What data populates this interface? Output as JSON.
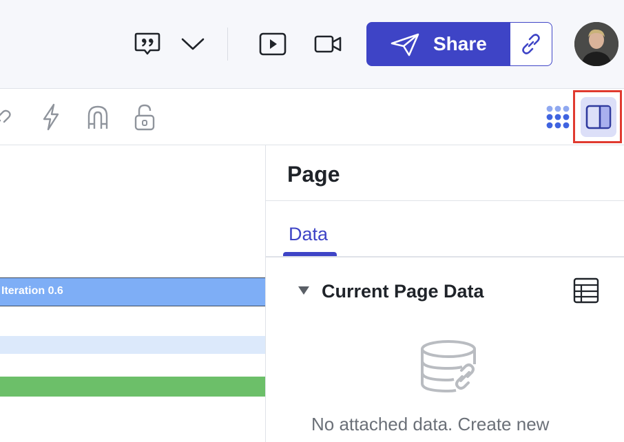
{
  "header": {
    "share_label": "Share",
    "accent_color": "#3e44c6",
    "icons": [
      "comment-quote-icon",
      "chevron-down-icon",
      "present-play-icon",
      "video-camera-icon",
      "paper-plane-icon",
      "link-icon",
      "avatar"
    ]
  },
  "toolbar": {
    "icons": [
      "link-icon",
      "lightning-icon",
      "magnet-icon",
      "unlock-icon",
      "apps-grid-icon",
      "panel-toggle-icon"
    ],
    "highlight_color": "#e03a2f"
  },
  "canvas": {
    "bar_label": "Iteration 0.6",
    "colors": {
      "blue": "#7eaef6",
      "light_blue": "#dce9fb",
      "green": "#6cbf69"
    }
  },
  "panel": {
    "title": "Page",
    "tabs": [
      {
        "label": "Data",
        "active": true
      }
    ],
    "section": {
      "title": "Current Page Data",
      "empty_text": "No attached data. Create new"
    }
  }
}
